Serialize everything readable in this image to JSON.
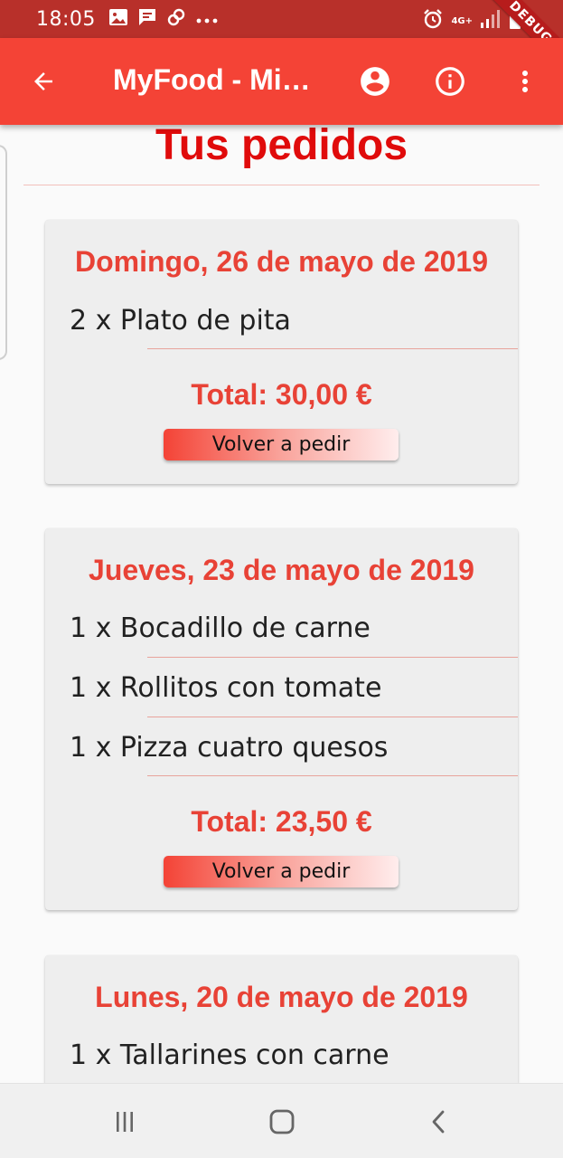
{
  "status_bar": {
    "time": "18:05",
    "debug_label": "DEBUG",
    "network_label": "4G+",
    "icons": [
      "image-icon",
      "chat-icon",
      "link-icon",
      "more-icon",
      "alarm-icon",
      "signal-icon",
      "battery-icon"
    ]
  },
  "app_bar": {
    "title": "MyFood - Mis pedidos",
    "icons": [
      "back-arrow-icon",
      "account-circle-icon",
      "info-icon",
      "more-vert-icon"
    ]
  },
  "page": {
    "title": "Tus pedidos"
  },
  "orders": [
    {
      "date": "Domingo, 26 de mayo de 2019",
      "items": [
        "2 x Plato de pita"
      ],
      "total": "Total: 30,00 €",
      "button": "Volver a pedir"
    },
    {
      "date": "Jueves, 23 de mayo de 2019",
      "items": [
        "1 x Bocadillo de carne",
        "1 x Rollitos con tomate",
        "1 x Pizza cuatro quesos"
      ],
      "total": "Total: 23,50 €",
      "button": "Volver a pedir"
    },
    {
      "date": "Lunes, 20 de mayo de 2019",
      "items": [
        "1 x Tallarines con carne"
      ]
    }
  ],
  "nav_bar": {
    "icons": [
      "recent-apps-icon",
      "home-icon",
      "back-icon"
    ]
  },
  "colors": {
    "app_bar": "#f44336",
    "status_bar": "#b8302a",
    "accent_red": "#e84236",
    "title_red": "#e00b0b"
  }
}
